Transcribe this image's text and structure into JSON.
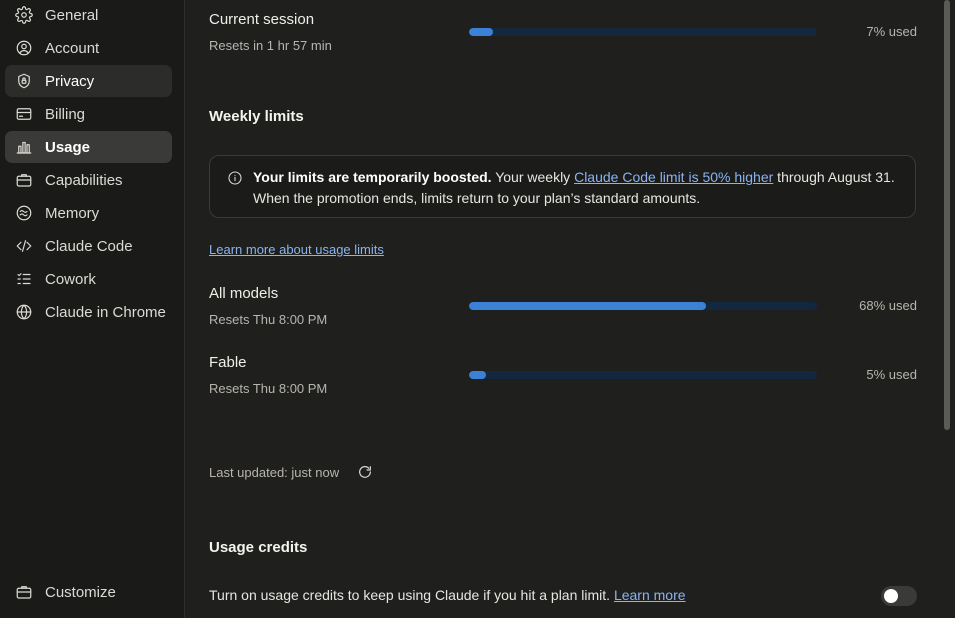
{
  "sidebar": {
    "items": [
      {
        "label": "General",
        "icon": "gear-icon"
      },
      {
        "label": "Account",
        "icon": "account-icon"
      },
      {
        "label": "Privacy",
        "icon": "shield-icon"
      },
      {
        "label": "Billing",
        "icon": "credit-card-icon"
      },
      {
        "label": "Usage",
        "icon": "bar-chart-icon"
      },
      {
        "label": "Capabilities",
        "icon": "briefcase-icon"
      },
      {
        "label": "Memory",
        "icon": "memory-icon"
      },
      {
        "label": "Claude Code",
        "icon": "code-icon"
      },
      {
        "label": "Cowork",
        "icon": "checklist-icon"
      },
      {
        "label": "Claude in Chrome",
        "icon": "globe-icon"
      }
    ],
    "customize": {
      "label": "Customize",
      "icon": "briefcase-icon"
    }
  },
  "session": {
    "title": "Current session",
    "resets": "Resets in 1 hr 57 min",
    "used_fraction": 0.07,
    "used_label": "7% used"
  },
  "weekly": {
    "heading": "Weekly limits",
    "notice": {
      "bold": "Your limits are temporarily boosted.",
      "text_before": " Your weekly ",
      "link": "Claude Code limit is 50% higher",
      "text_after": " through August 31. When the promotion ends, limits return to your plan’s standard amounts."
    },
    "learn_more": "Learn more about usage limits",
    "models": [
      {
        "title": "All models",
        "resets": "Resets Thu 8:00 PM",
        "used_fraction": 0.68,
        "used_label": "68% used"
      },
      {
        "title": "Fable",
        "resets": "Resets Thu 8:00 PM",
        "used_fraction": 0.05,
        "used_label": "5% used"
      }
    ]
  },
  "last_updated": "Last updated: just now",
  "credits": {
    "heading": "Usage credits",
    "text": "Turn on usage credits to keep using Claude if you hit a plan limit.",
    "learn_more": "Learn more",
    "toggle_on": false
  },
  "colors": {
    "accent": "#3b82d6",
    "track": "#13283f",
    "link": "#8ab4f0"
  }
}
